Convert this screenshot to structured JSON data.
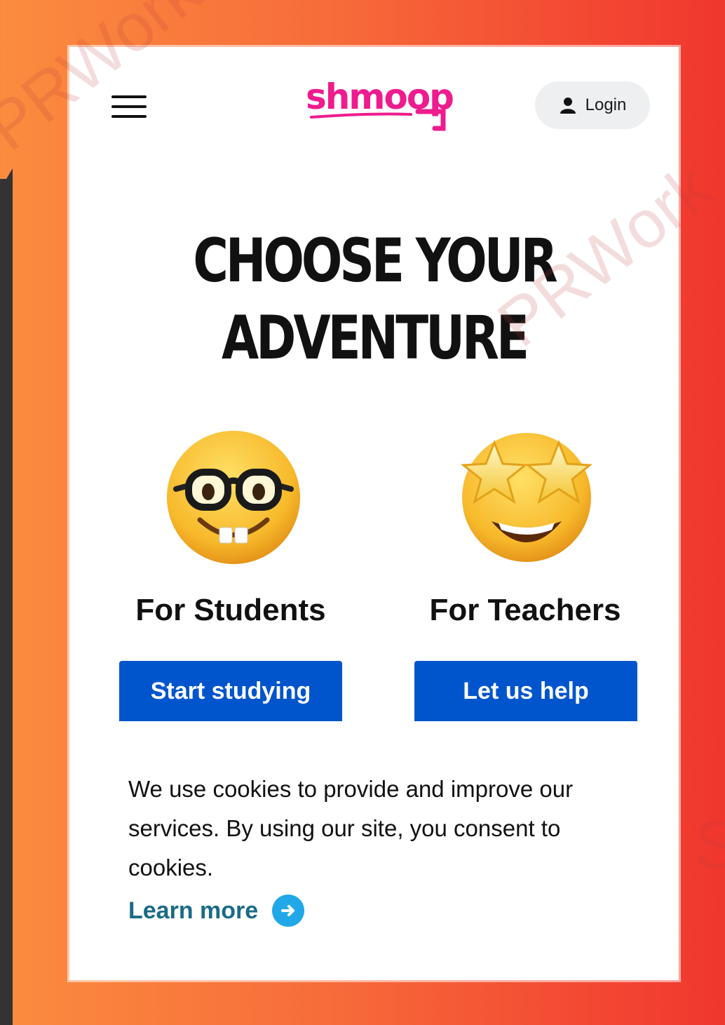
{
  "header": {
    "logo_text": "shmoop",
    "login_label": "Login"
  },
  "hero": {
    "headline_line1": "CHOOSE YOUR",
    "headline_line2": "ADVENTURE"
  },
  "audiences": [
    {
      "label": "For Students",
      "cta": "Start studying",
      "emoji": "nerd-face-icon"
    },
    {
      "label": "For Teachers",
      "cta": "Let us help",
      "emoji": "star-struck-icon"
    }
  ],
  "cookie_banner": {
    "text": "We use cookies to provide and improve our services. By using our site, you consent to cookies.",
    "link_label": "Learn more"
  },
  "watermark": {
    "text1": "PRWork Infosec",
    "text2": "PRWork",
    "text3": "S"
  },
  "colors": {
    "logo": "#ee1c8e",
    "cta": "#0055cc",
    "link": "#1a6b86",
    "arrow": "#22a8e8"
  }
}
